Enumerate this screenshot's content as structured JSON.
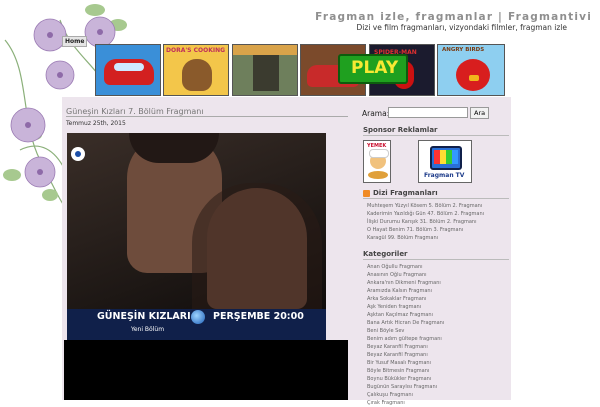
{
  "site": {
    "title": "Fragman izle, fragmanlar | Fragmantivi",
    "description": "Dizi ve film fragmanları, vizyondaki filmler, fragman izle",
    "home_label": "Home"
  },
  "banners": {
    "doras_label": "DORA'S COOKING",
    "play_label": "PLAY",
    "spider_label": "SPIDER-MAN",
    "angry_label": "ANGRY BIRDS"
  },
  "post": {
    "title": "Güneşin Kızları 7. Bölüm Fragmanı",
    "date": "Temmuz 25th, 2015",
    "lower_third_title": "GÜNEŞİN KIZLARI",
    "lower_third_time": "PERŞEMBE 20:00",
    "lower_third_sub": "Yeni Bölüm"
  },
  "search": {
    "label": "Arama:",
    "value": "",
    "button": "Ara"
  },
  "sponsor": {
    "heading": "Sponsor Reklamlar",
    "ad1_label": "YEMEK",
    "ad2_label": "Fragman TV"
  },
  "dizi": {
    "heading": "Dizi Fragmanları",
    "items": [
      "Muhteşem Yüzyıl Kösem 5. Bölüm 2. Fragmanı",
      "Kaderimin Yazıldığı Gün 47. Bölüm 2. Fragmanı",
      "İlişki Durumu Karışık 31. Bölüm 2. Fragmanı",
      "O Hayat Benim 71. Bölüm 3. Fragmanı",
      "Karagül 99. Bölüm Fragmanı"
    ]
  },
  "kategoriler": {
    "heading": "Kategoriler",
    "items": [
      "Anan Oğullu Fragmanı",
      "Anasının Oğlu Fragmanı",
      "Ankara'nın Dikmeni Fragmanı",
      "Aramızda Kalsın Fragmanı",
      "Arka Sokaklar Fragmanı",
      "Aşk Yeniden fragmanı",
      "Aşktan Kaçılmaz Fragmanı",
      "Bana Artık Hicran De Fragmanı",
      "Beni Böyle Sev",
      "Benim adım gültepe fragmanı",
      "Beyaz Karanfil Fragmanı",
      "Beyaz Karanfil Fragmanı",
      "Bir Yusuf Masalı Fragmanı",
      "Böyle Bitmesin Fragmanı",
      "Boynu Bükükler Fragmanı",
      "Bugünün Saraylısı Fragmanı",
      "Çalıkuşu Fragmanı",
      "Çırak Fragmanı"
    ]
  },
  "colors": {
    "pink_panel": "#ede5ed",
    "title_gray": "#8f8f8f",
    "rss_orange": "#f08a24",
    "play_green": "#1fa01f",
    "tv_navy": "#10204a"
  }
}
